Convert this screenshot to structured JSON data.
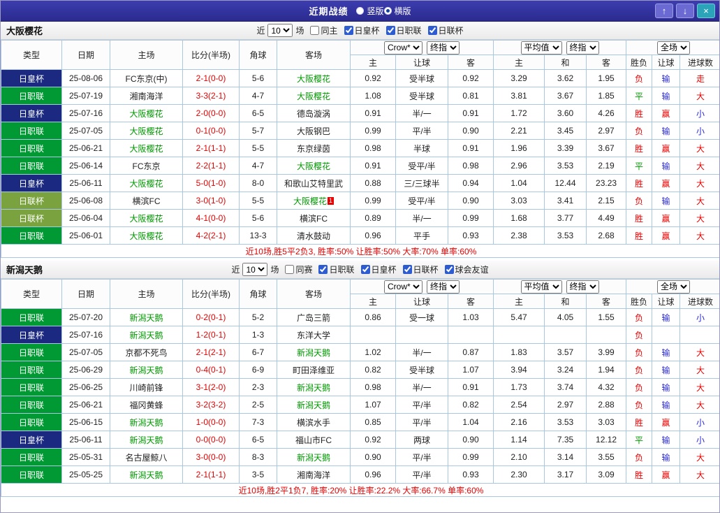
{
  "titlebar": {
    "title": "近期战绩",
    "radios": [
      {
        "label": "竖版",
        "selected": false
      },
      {
        "label": "横版",
        "selected": true
      }
    ],
    "buttons": {
      "up": "↑",
      "down": "↓",
      "close": "×"
    }
  },
  "colors": {
    "titlebar_bg": "#32329e",
    "checkbox_accent": "#2d5bd1",
    "grid_border": "#a9c6e3",
    "focus_team": "#009900",
    "score": "#e60000",
    "summary": "#e60000",
    "league": {
      "日职联": "#009933",
      "日皇杯": "#1b2a80",
      "日联杯": "#7aa23e"
    },
    "marks": {
      "胜": "#e60000",
      "平": "#009900",
      "负": "#e60000",
      "赢": "#e60000",
      "输": "#2929d6",
      "大": "#e60000",
      "小": "#2929d6",
      "走": "#e60000"
    }
  },
  "headers": {
    "main": [
      "类型",
      "日期",
      "主场",
      "比分(半场)",
      "角球",
      "客场"
    ],
    "sub": [
      "主",
      "让球",
      "客",
      "主",
      "和",
      "客",
      "胜负",
      "让球",
      "进球数"
    ]
  },
  "sections": [
    {
      "team": "大阪樱花",
      "filter": {
        "near_label": "近",
        "count": "10",
        "games_label": "场",
        "checkboxes": [
          {
            "label": "同主",
            "checked": false
          },
          {
            "label": "日皇杯",
            "checked": true
          },
          {
            "label": "日职联",
            "checked": true
          },
          {
            "label": "日联杯",
            "checked": true
          }
        ]
      },
      "selects": {
        "odds_company": "Crow*",
        "odds_stage": "终指",
        "avg": "平均值",
        "avg_stage": "终指",
        "scope": "全场"
      },
      "rows": [
        {
          "league": "日皇杯",
          "date": "25-08-06",
          "home": "FC东京(中)",
          "home_focus": false,
          "score": "2-1(0-0)",
          "corners": "5-6",
          "away": "大阪樱花",
          "away_focus": true,
          "away_red_card": "",
          "odds": [
            "0.92",
            "受半球",
            "0.92"
          ],
          "avg": [
            "3.29",
            "3.62",
            "1.95"
          ],
          "result": "负",
          "handicap": "输",
          "goals": "走"
        },
        {
          "league": "日职联",
          "date": "25-07-19",
          "home": "湘南海洋",
          "home_focus": false,
          "score": "3-3(2-1)",
          "corners": "4-7",
          "away": "大阪樱花",
          "away_focus": true,
          "away_red_card": "",
          "odds": [
            "1.08",
            "受半球",
            "0.81"
          ],
          "avg": [
            "3.81",
            "3.67",
            "1.85"
          ],
          "result": "平",
          "handicap": "输",
          "goals": "大"
        },
        {
          "league": "日皇杯",
          "date": "25-07-16",
          "home": "大阪樱花",
          "home_focus": true,
          "score": "2-0(0-0)",
          "corners": "6-5",
          "away": "德岛漩涡",
          "away_focus": false,
          "away_red_card": "",
          "odds": [
            "0.91",
            "半/一",
            "0.91"
          ],
          "avg": [
            "1.72",
            "3.60",
            "4.26"
          ],
          "result": "胜",
          "handicap": "赢",
          "goals": "小"
        },
        {
          "league": "日职联",
          "date": "25-07-05",
          "home": "大阪樱花",
          "home_focus": true,
          "score": "0-1(0-0)",
          "corners": "5-7",
          "away": "大阪钢巴",
          "away_focus": false,
          "away_red_card": "",
          "odds": [
            "0.99",
            "平/半",
            "0.90"
          ],
          "avg": [
            "2.21",
            "3.45",
            "2.97"
          ],
          "result": "负",
          "handicap": "输",
          "goals": "小"
        },
        {
          "league": "日职联",
          "date": "25-06-21",
          "home": "大阪樱花",
          "home_focus": true,
          "score": "2-1(1-1)",
          "corners": "5-5",
          "away": "东京绿茵",
          "away_focus": false,
          "away_red_card": "",
          "odds": [
            "0.98",
            "半球",
            "0.91"
          ],
          "avg": [
            "1.96",
            "3.39",
            "3.67"
          ],
          "result": "胜",
          "handicap": "赢",
          "goals": "大"
        },
        {
          "league": "日职联",
          "date": "25-06-14",
          "home": "FC东京",
          "home_focus": false,
          "score": "2-2(1-1)",
          "corners": "4-7",
          "away": "大阪樱花",
          "away_focus": true,
          "away_red_card": "",
          "odds": [
            "0.91",
            "受平/半",
            "0.98"
          ],
          "avg": [
            "2.96",
            "3.53",
            "2.19"
          ],
          "result": "平",
          "handicap": "输",
          "goals": "大"
        },
        {
          "league": "日皇杯",
          "date": "25-06-11",
          "home": "大阪樱花",
          "home_focus": true,
          "score": "5-0(1-0)",
          "corners": "8-0",
          "away": "和歌山艾特里武",
          "away_focus": false,
          "away_red_card": "",
          "odds": [
            "0.88",
            "三/三球半",
            "0.94"
          ],
          "avg": [
            "1.04",
            "12.44",
            "23.23"
          ],
          "result": "胜",
          "handicap": "赢",
          "goals": "大"
        },
        {
          "league": "日联杯",
          "date": "25-06-08",
          "home": "横滨FC",
          "home_focus": false,
          "score": "3-0(1-0)",
          "corners": "5-5",
          "away": "大阪樱花",
          "away_focus": true,
          "away_red_card": "1",
          "odds": [
            "0.99",
            "受平/半",
            "0.90"
          ],
          "avg": [
            "3.03",
            "3.41",
            "2.15"
          ],
          "result": "负",
          "handicap": "输",
          "goals": "大"
        },
        {
          "league": "日联杯",
          "date": "25-06-04",
          "home": "大阪樱花",
          "home_focus": true,
          "score": "4-1(0-0)",
          "corners": "5-6",
          "away": "横滨FC",
          "away_focus": false,
          "away_red_card": "",
          "odds": [
            "0.89",
            "半/一",
            "0.99"
          ],
          "avg": [
            "1.68",
            "3.77",
            "4.49"
          ],
          "result": "胜",
          "handicap": "赢",
          "goals": "大"
        },
        {
          "league": "日职联",
          "date": "25-06-01",
          "home": "大阪樱花",
          "home_focus": true,
          "score": "4-2(2-1)",
          "corners": "13-3",
          "away": "清水鼓动",
          "away_focus": false,
          "away_red_card": "",
          "odds": [
            "0.96",
            "平手",
            "0.93"
          ],
          "avg": [
            "2.38",
            "3.53",
            "2.68"
          ],
          "result": "胜",
          "handicap": "赢",
          "goals": "大"
        }
      ],
      "summary": "近10场,胜5平2负3, 胜率:50% 让胜率:50% 大率:70% 单率:60%"
    },
    {
      "team": "新潟天鹅",
      "filter": {
        "near_label": "近",
        "count": "10",
        "games_label": "场",
        "checkboxes": [
          {
            "label": "同赛",
            "checked": false
          },
          {
            "label": "日职联",
            "checked": true
          },
          {
            "label": "日皇杯",
            "checked": true
          },
          {
            "label": "日联杯",
            "checked": true
          },
          {
            "label": "球会友谊",
            "checked": true
          }
        ]
      },
      "selects": {
        "odds_company": "Crow*",
        "odds_stage": "终指",
        "avg": "平均值",
        "avg_stage": "终指",
        "scope": "全场"
      },
      "rows": [
        {
          "league": "日职联",
          "date": "25-07-20",
          "home": "新潟天鹅",
          "home_focus": true,
          "score": "0-2(0-1)",
          "corners": "5-2",
          "away": "广岛三箭",
          "away_focus": false,
          "away_red_card": "",
          "odds": [
            "0.86",
            "受一球",
            "1.03"
          ],
          "avg": [
            "5.47",
            "4.05",
            "1.55"
          ],
          "result": "负",
          "handicap": "输",
          "goals": "小"
        },
        {
          "league": "日皇杯",
          "date": "25-07-16",
          "home": "新潟天鹅",
          "home_focus": true,
          "score": "1-2(0-1)",
          "corners": "1-3",
          "away": "东洋大学",
          "away_focus": false,
          "away_red_card": "",
          "odds": [
            "",
            "",
            ""
          ],
          "avg": [
            "",
            "",
            ""
          ],
          "result": "负",
          "handicap": "",
          "goals": ""
        },
        {
          "league": "日职联",
          "date": "25-07-05",
          "home": "京都不死鸟",
          "home_focus": false,
          "score": "2-1(2-1)",
          "corners": "6-7",
          "away": "新潟天鹅",
          "away_focus": true,
          "away_red_card": "",
          "odds": [
            "1.02",
            "半/一",
            "0.87"
          ],
          "avg": [
            "1.83",
            "3.57",
            "3.99"
          ],
          "result": "负",
          "handicap": "输",
          "goals": "大"
        },
        {
          "league": "日职联",
          "date": "25-06-29",
          "home": "新潟天鹅",
          "home_focus": true,
          "score": "0-4(0-1)",
          "corners": "6-9",
          "away": "町田泽维亚",
          "away_focus": false,
          "away_red_card": "",
          "odds": [
            "0.82",
            "受半球",
            "1.07"
          ],
          "avg": [
            "3.94",
            "3.24",
            "1.94"
          ],
          "result": "负",
          "handicap": "输",
          "goals": "大"
        },
        {
          "league": "日职联",
          "date": "25-06-25",
          "home": "川崎前锋",
          "home_focus": false,
          "score": "3-1(2-0)",
          "corners": "2-3",
          "away": "新潟天鹅",
          "away_focus": true,
          "away_red_card": "",
          "odds": [
            "0.98",
            "半/一",
            "0.91"
          ],
          "avg": [
            "1.73",
            "3.74",
            "4.32"
          ],
          "result": "负",
          "handicap": "输",
          "goals": "大"
        },
        {
          "league": "日职联",
          "date": "25-06-21",
          "home": "福冈黄蜂",
          "home_focus": false,
          "score": "3-2(3-2)",
          "corners": "2-5",
          "away": "新潟天鹅",
          "away_focus": true,
          "away_red_card": "",
          "odds": [
            "1.07",
            "平/半",
            "0.82"
          ],
          "avg": [
            "2.54",
            "2.97",
            "2.88"
          ],
          "result": "负",
          "handicap": "输",
          "goals": "大"
        },
        {
          "league": "日职联",
          "date": "25-06-15",
          "home": "新潟天鹅",
          "home_focus": true,
          "score": "1-0(0-0)",
          "corners": "7-3",
          "away": "横滨水手",
          "away_focus": false,
          "away_red_card": "",
          "odds": [
            "0.85",
            "平/半",
            "1.04"
          ],
          "avg": [
            "2.16",
            "3.53",
            "3.03"
          ],
          "result": "胜",
          "handicap": "赢",
          "goals": "小"
        },
        {
          "league": "日皇杯",
          "date": "25-06-11",
          "home": "新潟天鹅",
          "home_focus": true,
          "score": "0-0(0-0)",
          "corners": "6-5",
          "away": "福山市FC",
          "away_focus": false,
          "away_red_card": "",
          "odds": [
            "0.92",
            "两球",
            "0.90"
          ],
          "avg": [
            "1.14",
            "7.35",
            "12.12"
          ],
          "result": "平",
          "handicap": "输",
          "goals": "小"
        },
        {
          "league": "日职联",
          "date": "25-05-31",
          "home": "名古屋鲸八",
          "home_focus": false,
          "score": "3-0(0-0)",
          "corners": "8-3",
          "away": "新潟天鹅",
          "away_focus": true,
          "away_red_card": "",
          "odds": [
            "0.90",
            "平/半",
            "0.99"
          ],
          "avg": [
            "2.10",
            "3.14",
            "3.55"
          ],
          "result": "负",
          "handicap": "输",
          "goals": "大"
        },
        {
          "league": "日职联",
          "date": "25-05-25",
          "home": "新潟天鹅",
          "home_focus": true,
          "score": "2-1(1-1)",
          "corners": "3-5",
          "away": "湘南海洋",
          "away_focus": false,
          "away_red_card": "",
          "odds": [
            "0.96",
            "平/半",
            "0.93"
          ],
          "avg": [
            "2.30",
            "3.17",
            "3.09"
          ],
          "result": "胜",
          "handicap": "赢",
          "goals": "大"
        }
      ],
      "summary": "近10场,胜2平1负7, 胜率:20% 让胜率:22.2% 大率:66.7% 单率:60%"
    }
  ]
}
